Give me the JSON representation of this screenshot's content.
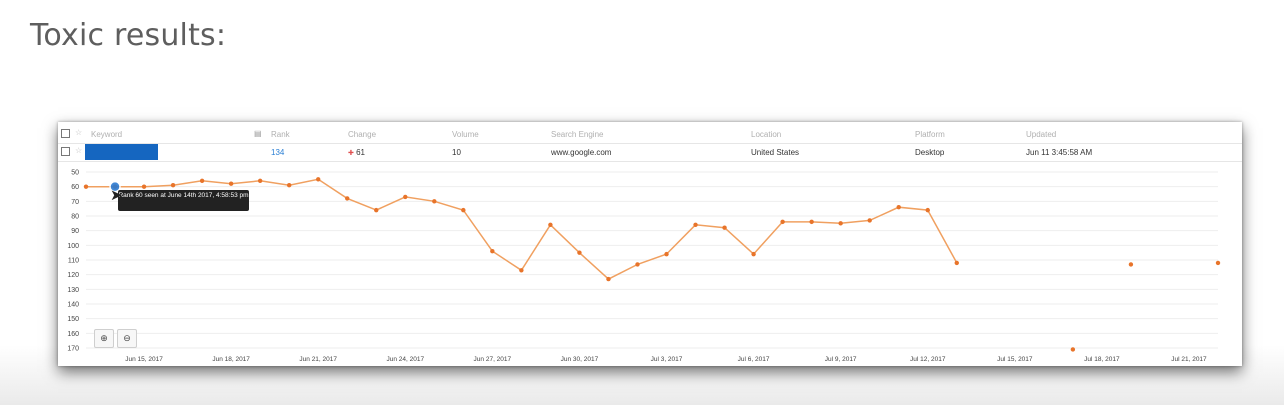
{
  "page": {
    "heading": "Toxic results:"
  },
  "table": {
    "columns": [
      "Keyword",
      "Rank",
      "Change",
      "Volume",
      "Search Engine",
      "Location",
      "Platform",
      "Updated"
    ],
    "row": {
      "keyword": "",
      "rank": "134",
      "change_icon": "arrow-down-icon",
      "change": "61",
      "volume": "10",
      "search_engine": "www.google.com",
      "location": "United States",
      "platform": "Desktop",
      "updated": "Jun 11 3:45:58 AM"
    }
  },
  "tooltip": {
    "text": "Rank 60 seen at June 14th 2017, 4:58:53 pm"
  },
  "colors": {
    "line": "#f0a060",
    "point": "#e8742a",
    "tooltip_bg": "#222222",
    "keyword_redaction": "#1566c0"
  },
  "chart_data": {
    "type": "line",
    "title": "",
    "xlabel": "",
    "ylabel": "",
    "y_reversed": true,
    "ylim": [
      50,
      170
    ],
    "y_ticks": [
      50,
      60,
      70,
      80,
      90,
      100,
      110,
      120,
      130,
      140,
      150,
      160,
      170
    ],
    "x_ticks": [
      "Jun 15, 2017",
      "Jun 18, 2017",
      "Jun 21, 2017",
      "Jun 24, 2017",
      "Jun 27, 2017",
      "Jun 30, 2017",
      "Jul 3, 2017",
      "Jul 6, 2017",
      "Jul 9, 2017",
      "Jul 12, 2017",
      "Jul 15, 2017",
      "Jul 18, 2017",
      "Jul 21, 2017"
    ],
    "x_start": "Jun 13, 2017",
    "x_end": "Jul 22, 2017",
    "series": [
      {
        "points": [
          {
            "x": "Jun 13, 2017",
            "y": 60
          },
          {
            "x": "Jun 14, 2017",
            "y": 60
          },
          {
            "x": "Jun 15, 2017",
            "y": 60
          },
          {
            "x": "Jun 16, 2017",
            "y": 59
          },
          {
            "x": "Jun 17, 2017",
            "y": 56
          },
          {
            "x": "Jun 18, 2017",
            "y": 58
          },
          {
            "x": "Jun 19, 2017",
            "y": 56
          },
          {
            "x": "Jun 20, 2017",
            "y": 59
          },
          {
            "x": "Jun 21, 2017",
            "y": 55
          },
          {
            "x": "Jun 22, 2017",
            "y": 68
          },
          {
            "x": "Jun 23, 2017",
            "y": 76
          },
          {
            "x": "Jun 24, 2017",
            "y": 67
          },
          {
            "x": "Jun 25, 2017",
            "y": 70
          },
          {
            "x": "Jun 26, 2017",
            "y": 76
          },
          {
            "x": "Jun 27, 2017",
            "y": 104
          },
          {
            "x": "Jun 28, 2017",
            "y": 117
          },
          {
            "x": "Jun 29, 2017",
            "y": 86
          },
          {
            "x": "Jun 30, 2017",
            "y": 105
          },
          {
            "x": "Jul 1, 2017",
            "y": 123
          },
          {
            "x": "Jul 2, 2017",
            "y": 113
          },
          {
            "x": "Jul 3, 2017",
            "y": 106
          },
          {
            "x": "Jul 4, 2017",
            "y": 86
          },
          {
            "x": "Jul 5, 2017",
            "y": 88
          },
          {
            "x": "Jul 6, 2017",
            "y": 106
          },
          {
            "x": "Jul 7, 2017",
            "y": 84
          },
          {
            "x": "Jul 8, 2017",
            "y": 84
          },
          {
            "x": "Jul 9, 2017",
            "y": 85
          },
          {
            "x": "Jul 10, 2017",
            "y": 83
          },
          {
            "x": "Jul 11, 2017",
            "y": 74
          },
          {
            "x": "Jul 12, 2017",
            "y": 76
          },
          {
            "x": "Jul 13, 2017",
            "y": 112
          },
          {
            "x": "Jul 17, 2017",
            "y": 171,
            "isolated": true
          },
          {
            "x": "Jul 19, 2017",
            "y": 113,
            "isolated": true
          },
          {
            "x": "Jul 22, 2017",
            "y": 112,
            "isolated": true
          }
        ]
      }
    ],
    "grid": "horizontal",
    "legend": "none"
  }
}
